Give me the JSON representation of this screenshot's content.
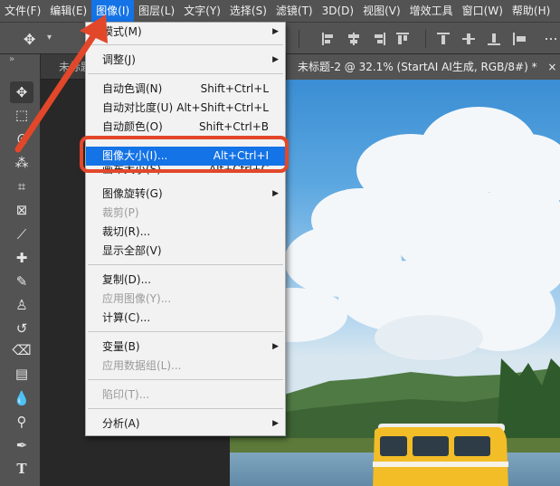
{
  "menubar": {
    "items": [
      {
        "label": "文件(F)"
      },
      {
        "label": "编辑(E)"
      },
      {
        "label": "图像(I)"
      },
      {
        "label": "图层(L)"
      },
      {
        "label": "文字(Y)"
      },
      {
        "label": "选择(S)"
      },
      {
        "label": "滤镜(T)"
      },
      {
        "label": "3D(D)"
      },
      {
        "label": "视图(V)"
      },
      {
        "label": "增效工具"
      },
      {
        "label": "窗口(W)"
      },
      {
        "label": "帮助(H)"
      }
    ]
  },
  "tabs": {
    "inactive_label": "未标题-",
    "active_label": "未标题-2 @ 32.1% (StartAI AI生成, RGB/8#) *",
    "close_glyph": "×"
  },
  "toolbar": {
    "collapse_glyph": "»",
    "tools": [
      {
        "name": "move-tool-icon",
        "glyph": "✥"
      },
      {
        "name": "marquee-tool-icon",
        "glyph": "⬚"
      },
      {
        "name": "lasso-tool-icon",
        "glyph": "ᘓ"
      },
      {
        "name": "magic-wand-tool-icon",
        "glyph": "⁂"
      },
      {
        "name": "crop-tool-icon",
        "glyph": "⌗"
      },
      {
        "name": "frame-tool-icon",
        "glyph": "⊠"
      },
      {
        "name": "eyedropper-tool-icon",
        "glyph": "⟋"
      },
      {
        "name": "healing-tool-icon",
        "glyph": "✚"
      },
      {
        "name": "brush-tool-icon",
        "glyph": "✎"
      },
      {
        "name": "stamp-tool-icon",
        "glyph": "♙"
      },
      {
        "name": "history-brush-tool-icon",
        "glyph": "↺"
      },
      {
        "name": "eraser-tool-icon",
        "glyph": "⌫"
      },
      {
        "name": "gradient-tool-icon",
        "glyph": "▤"
      },
      {
        "name": "blur-tool-icon",
        "glyph": "💧"
      },
      {
        "name": "dodge-tool-icon",
        "glyph": "⚲"
      },
      {
        "name": "pen-tool-icon",
        "glyph": "✒"
      },
      {
        "name": "type-tool-icon",
        "glyph": "T"
      }
    ]
  },
  "image_menu": {
    "items": [
      {
        "label": "模式(M)",
        "shortcut": "",
        "submenu": true,
        "disabled": false
      },
      {
        "label": "调整(J)",
        "shortcut": "",
        "submenu": true,
        "disabled": false
      },
      {
        "label": "自动色调(N)",
        "shortcut": "Shift+Ctrl+L",
        "submenu": false,
        "disabled": false
      },
      {
        "label": "自动对比度(U)",
        "shortcut": "Alt+Shift+Ctrl+L",
        "submenu": false,
        "disabled": false
      },
      {
        "label": "自动颜色(O)",
        "shortcut": "Shift+Ctrl+B",
        "submenu": false,
        "disabled": false
      },
      {
        "label": "图像大小(I)...",
        "shortcut": "Alt+Ctrl+I",
        "submenu": false,
        "disabled": false,
        "highlighted": true
      },
      {
        "label": "画布大小(S)...",
        "shortcut": "Alt+Ctrl+C",
        "submenu": false,
        "disabled": false
      },
      {
        "label": "图像旋转(G)",
        "shortcut": "",
        "submenu": true,
        "disabled": false
      },
      {
        "label": "裁剪(P)",
        "shortcut": "",
        "submenu": false,
        "disabled": true
      },
      {
        "label": "裁切(R)...",
        "shortcut": "",
        "submenu": false,
        "disabled": false
      },
      {
        "label": "显示全部(V)",
        "shortcut": "",
        "submenu": false,
        "disabled": false
      },
      {
        "label": "复制(D)...",
        "shortcut": "",
        "submenu": false,
        "disabled": false
      },
      {
        "label": "应用图像(Y)...",
        "shortcut": "",
        "submenu": false,
        "disabled": true
      },
      {
        "label": "计算(C)...",
        "shortcut": "",
        "submenu": false,
        "disabled": false
      },
      {
        "label": "变量(B)",
        "shortcut": "",
        "submenu": true,
        "disabled": false
      },
      {
        "label": "应用数据组(L)...",
        "shortcut": "",
        "submenu": false,
        "disabled": true
      },
      {
        "label": "陷印(T)...",
        "shortcut": "",
        "submenu": false,
        "disabled": true
      },
      {
        "label": "分析(A)",
        "shortcut": "",
        "submenu": true,
        "disabled": false
      }
    ],
    "submenu_glyph": "▶"
  },
  "colors": {
    "accent": "#1473e6",
    "annotation": "#e2472a"
  }
}
